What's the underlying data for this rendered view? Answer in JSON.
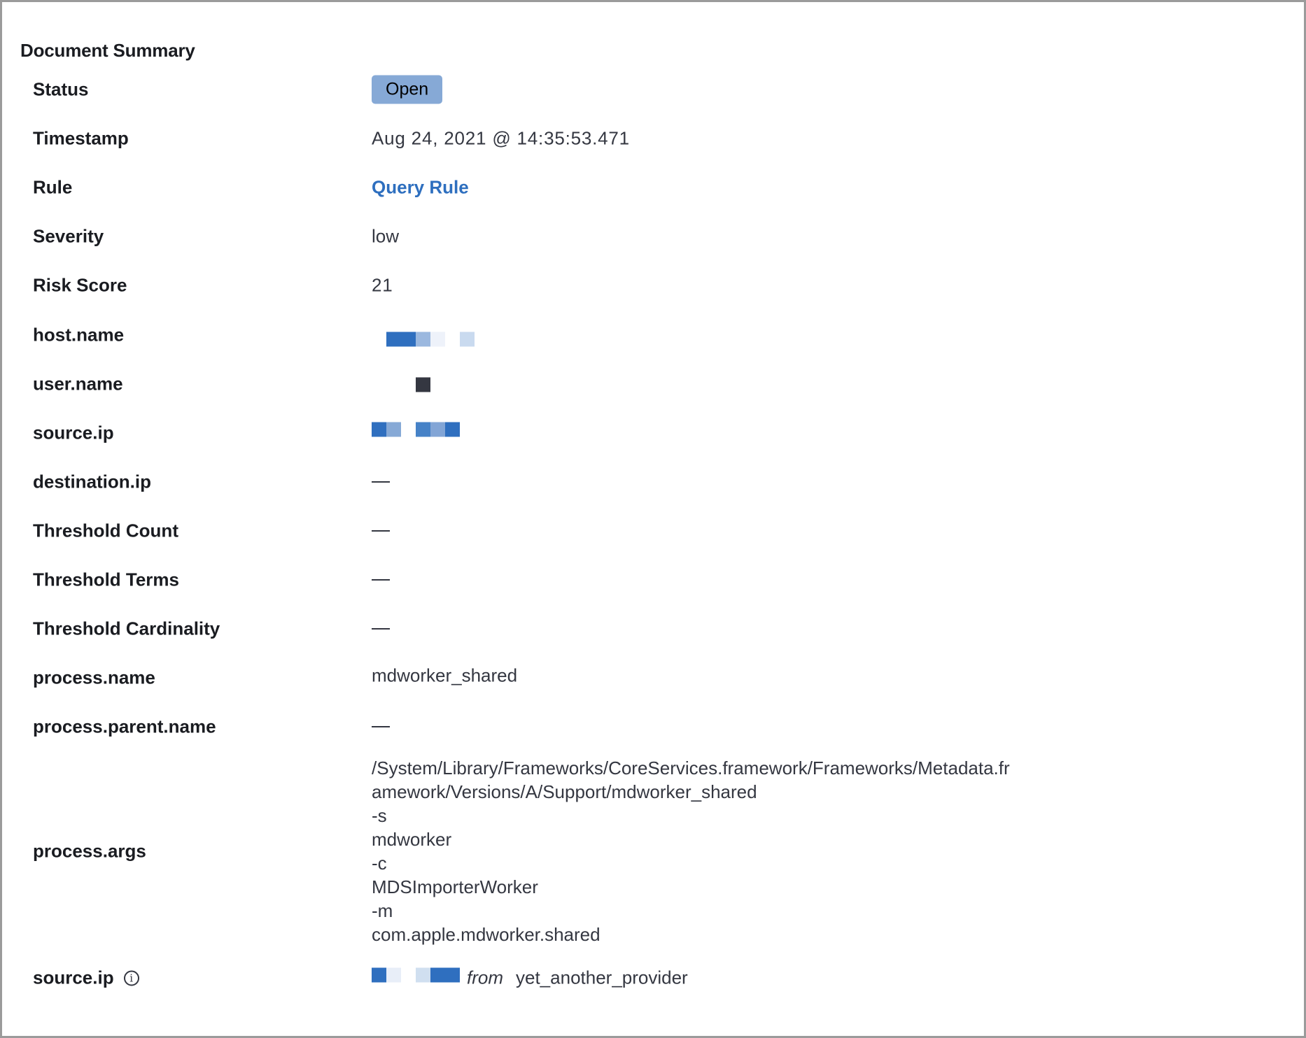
{
  "panel": {
    "title": "Document Summary"
  },
  "fields": {
    "status": {
      "label": "Status",
      "value": "Open"
    },
    "timestamp": {
      "label": "Timestamp",
      "value": "Aug 24, 2021 @ 14:35:53.471"
    },
    "rule": {
      "label": "Rule",
      "value": "Query Rule"
    },
    "severity": {
      "label": "Severity",
      "value": "low"
    },
    "risk_score": {
      "label": "Risk Score",
      "value": "21"
    },
    "host_name": {
      "label": "host.name",
      "value_icon": "redacted-pixel-block"
    },
    "user_name": {
      "label": "user.name",
      "value_icon": "redacted-pixel-block"
    },
    "source_ip": {
      "label": "source.ip",
      "value_icon": "redacted-pixel-block"
    },
    "destination_ip": {
      "label": "destination.ip",
      "value": "—"
    },
    "threshold_count": {
      "label": "Threshold Count",
      "value": "—"
    },
    "threshold_terms": {
      "label": "Threshold Terms",
      "value": "—"
    },
    "threshold_cardinality": {
      "label": "Threshold Cardinality",
      "value": "—"
    },
    "process_name": {
      "label": "process.name",
      "value": "mdworker_shared"
    },
    "process_parent_name": {
      "label": "process.parent.name",
      "value": "—"
    },
    "process_args": {
      "label": "process.args",
      "values": [
        "/System/Library/Frameworks/CoreServices.framework/Frameworks/Metadata.fr",
        "amework/Versions/A/Support/mdworker_shared",
        "-s",
        "mdworker",
        "-c",
        "MDSImporterWorker",
        "-m",
        "com.apple.mdworker.shared"
      ]
    },
    "source_ip_enriched": {
      "label": "source.ip",
      "info_icon": "info-circle-icon",
      "from_label": "from",
      "provider": "yet_another_provider"
    }
  },
  "colors": {
    "status_badge": "#86a9d6",
    "link": "#2e6fbf",
    "redact_dark_blue": "#2f6fbf",
    "redact_mid_blue": "#86a9d6",
    "redact_light_blue": "#c9daef",
    "redact_pale_blue": "#eef2fa",
    "redact_dark": "#343741"
  }
}
